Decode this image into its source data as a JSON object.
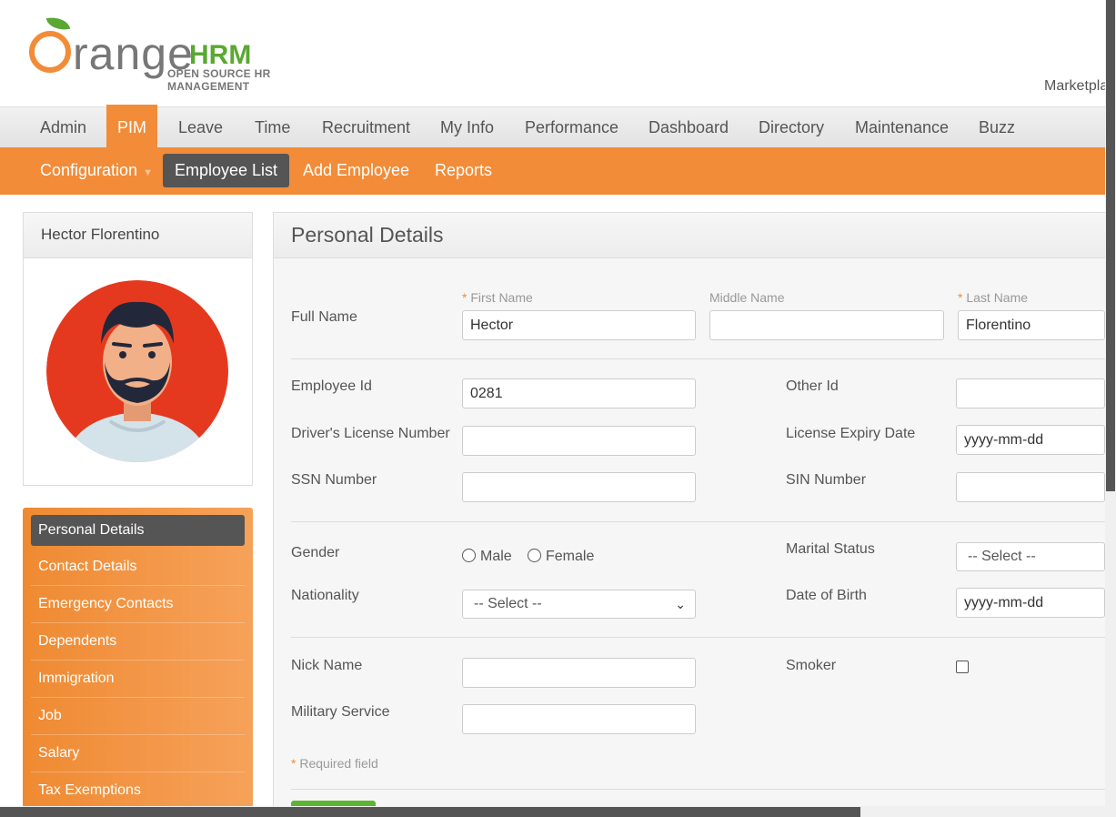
{
  "header": {
    "logo_word": "range",
    "logo_hrm": "HRM",
    "logo_tagline": "OPEN SOURCE HR MANAGEMENT",
    "marketplace": "Marketplace"
  },
  "topnav": [
    "Admin",
    "PIM",
    "Leave",
    "Time",
    "Recruitment",
    "My Info",
    "Performance",
    "Dashboard",
    "Directory",
    "Maintenance",
    "Buzz"
  ],
  "subnav": {
    "configuration": "Configuration",
    "employee_list": "Employee List",
    "add_employee": "Add Employee",
    "reports": "Reports"
  },
  "profile": {
    "name": "Hector Florentino"
  },
  "left_menu": [
    "Personal Details",
    "Contact Details",
    "Emergency Contacts",
    "Dependents",
    "Immigration",
    "Job",
    "Salary",
    "Tax Exemptions"
  ],
  "form": {
    "title": "Personal Details",
    "full_name_label": "Full Name",
    "first_name_label": "First Name",
    "middle_name_label": "Middle Name",
    "last_name_label": "Last Name",
    "first_name": "Hector",
    "middle_name": "",
    "last_name": "Florentino",
    "employee_id_label": "Employee Id",
    "employee_id": "0281",
    "other_id_label": "Other Id",
    "other_id": "",
    "license_label": "Driver's License Number",
    "license": "",
    "license_expiry_label": "License Expiry Date",
    "license_expiry": "yyyy-mm-dd",
    "ssn_label": "SSN Number",
    "sin_label": "SIN Number",
    "gender_label": "Gender",
    "gender_male": "Male",
    "gender_female": "Female",
    "marital_label": "Marital Status",
    "marital_value": "-- Select --",
    "nationality_label": "Nationality",
    "nationality_value": "-- Select --",
    "dob_label": "Date of Birth",
    "dob": "yyyy-mm-dd",
    "nick_label": "Nick Name",
    "smoker_label": "Smoker",
    "military_label": "Military Service",
    "required_note": "Required field",
    "required_mark": "*"
  },
  "colors": {
    "brand_orange": "#f28c38",
    "active_dark": "#555555",
    "save_green": "#5cb531"
  }
}
